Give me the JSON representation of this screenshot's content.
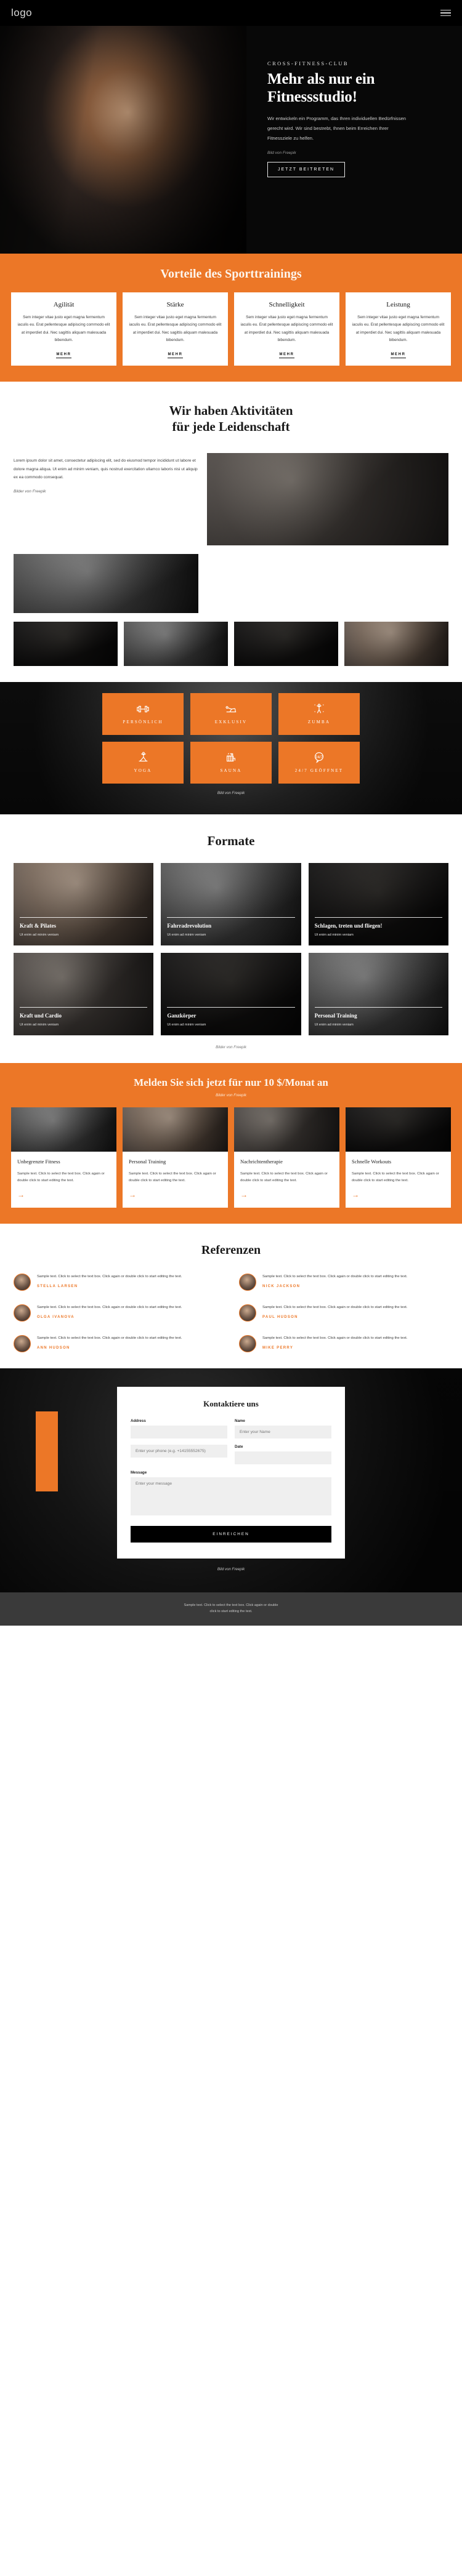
{
  "header": {
    "logo": "logo",
    "menu_icon": "hamburger-menu-icon"
  },
  "hero": {
    "eyebrow": "CROSS-FITNESS-CLUB",
    "title": "Mehr als nur ein Fitnessstudio!",
    "paragraph": "Wir entwickeln ein Programm, das Ihren individuellen Bedürfnissen gerecht wird. Wir sind bestrebt, Ihnen beim Erreichen Ihrer Fitnessziele zu helfen.",
    "credit": "Bild von Freepik",
    "cta": "JETZT BEITRETEN"
  },
  "benefits": {
    "title": "Vorteile des Sporttrainings",
    "more_label": "MEHR",
    "body": "Sem integer vitae justo eget magna fermentum iaculis eu. Erat pellentesque adipiscing commodo elit at imperdiet dui. Nec sagittis aliquam malesuada bibendum.",
    "cards": [
      {
        "title": "Agilität"
      },
      {
        "title": "Stärke"
      },
      {
        "title": "Schnelligkeit"
      },
      {
        "title": "Leistung"
      }
    ]
  },
  "activities": {
    "title_line1": "Wir haben Aktivitäten",
    "title_line2": "für jede Leidenschaft",
    "paragraph": "Lorem ipsum dolor sit amet, consectetur adipiscing elit, sed do eiusmod tempor incididunt ut labore et dolore magna aliqua. Ut enim ad minim veniam, quis nostrud exercitation ullamco laboris nisi ut aliquip ex ea commodo consequat.",
    "credit": "Bilder von Freepik"
  },
  "icon_band": {
    "credit": "Bild von Freepik",
    "tiles": [
      {
        "label": "PERSÖNLICH",
        "icon": "dumbbell-icon"
      },
      {
        "label": "EXKLUSIV",
        "icon": "plank-exercise-icon"
      },
      {
        "label": "ZUMBA",
        "icon": "dancer-icon"
      },
      {
        "label": "YOGA",
        "icon": "yoga-pose-icon"
      },
      {
        "label": "SAUNA",
        "icon": "sauna-icon"
      },
      {
        "label": "24/7 GEÖFFNET",
        "icon": "24-7-icon"
      }
    ]
  },
  "formate": {
    "title": "Formate",
    "credit": "Bilder von Freepik",
    "cards": [
      {
        "title": "Kraft & Pilates",
        "text": "Ut enim ad minim veniam"
      },
      {
        "title": "Fahrradrevolution",
        "text": "Ut enim ad minim veniam"
      },
      {
        "title": "Schlagen, treten und fliegen!",
        "text": "Ut enim ad minim veniam"
      },
      {
        "title": "Kraft und Cardio",
        "text": "Ut enim ad minim veniam"
      },
      {
        "title": "Ganzkörper",
        "text": "Ut enim ad minim veniam"
      },
      {
        "title": "Personal Training",
        "text": "Ut enim ad minim veniam"
      }
    ]
  },
  "pricing": {
    "title": "Melden Sie sich jetzt für nur 10 $/Monat an",
    "credit": "Bilder von Freepik",
    "body": "Sample text. Click to select the text box. Click again or double click to start editing the text.",
    "arrow": "→",
    "cards": [
      {
        "title": "Unbegrenzte Fitness"
      },
      {
        "title": "Personal Training"
      },
      {
        "title": "Nachrichtentherapie"
      },
      {
        "title": "Schnelle Workouts"
      }
    ]
  },
  "references": {
    "title": "Referenzen",
    "body": "Sample text. Click to select the text box. Click again or double click to start editing the text.",
    "items": [
      {
        "name": "STELLA LARSEN"
      },
      {
        "name": "NICK JACKSON"
      },
      {
        "name": "OLGA IVANOVA"
      },
      {
        "name": "PAUL HUDSON"
      },
      {
        "name": "ANN HUDSON"
      },
      {
        "name": "MIKE PERRY"
      }
    ]
  },
  "contact": {
    "title": "Kontaktiere uns",
    "address_label": "Address",
    "address_value": "",
    "name_label": "Name",
    "name_placeholder": "Enter your Name",
    "phone_placeholder": "Enter your phone (e.g. +14155552675)",
    "date_label": "Date",
    "date_value": "",
    "message_label": "Message",
    "message_placeholder": "Enter your message",
    "submit": "EINREICHEN",
    "credit": "Bild von Freepik"
  },
  "footer": {
    "line1": "Sample text. Click to select the text box. Click again or double",
    "line2": "click to start editing the text."
  },
  "colors": {
    "accent": "#ec7727",
    "dark": "#000000",
    "footer": "#3a3a3a"
  }
}
